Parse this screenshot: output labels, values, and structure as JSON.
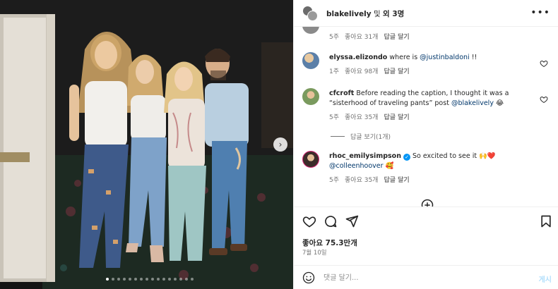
{
  "header": {
    "username": "blakelively",
    "conjunction": "및",
    "others": "외 3명",
    "more_icon": "more-horizontal-icon"
  },
  "comments": {
    "partial": {
      "time": "5주",
      "likes": "좋아요 31개",
      "reply": "답글 달기"
    },
    "items": [
      {
        "username": "elyssa.elizondo",
        "text_before": "where is ",
        "mention": "@justinbaldoni",
        "text_after": " !!",
        "time": "1주",
        "likes": "좋아요 98개",
        "reply": "답글 달기"
      },
      {
        "username": "cfcroft",
        "text_before": "Before reading the caption, I thought it was a “sisterhood of traveling pants” post ",
        "mention": "@blakelively",
        "text_after": " 😂",
        "time": "5주",
        "likes": "좋아요 35개",
        "reply": "답글 달기",
        "view_replies": "답글 보기(1개)"
      },
      {
        "username": "rhoc_emilysimpson",
        "text_before": " So excited to see it 🙌❤️ ",
        "mention": "@colleenhoover",
        "text_after": " 🥰",
        "time": "5주",
        "likes": "좋아요 35개",
        "reply": "답글 달기"
      }
    ]
  },
  "actions": {
    "likes": "좋아요 75.3만개",
    "date": "7월 10일"
  },
  "comment_box": {
    "placeholder": "댓글 달기...",
    "post_label": "게시"
  },
  "colors": {
    "link": "#00376b",
    "secondary_text": "#737373",
    "post_disabled": "#b2dffc",
    "verified": "#0095f6"
  }
}
